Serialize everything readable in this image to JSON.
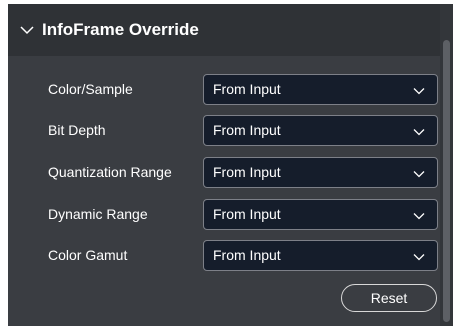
{
  "panel": {
    "title": "InfoFrame Override",
    "rows": [
      {
        "label": "Color/Sample",
        "value": "From Input"
      },
      {
        "label": "Bit Depth",
        "value": "From Input"
      },
      {
        "label": "Quantization Range",
        "value": "From Input"
      },
      {
        "label": "Dynamic Range",
        "value": "From Input"
      },
      {
        "label": "Color Gamut",
        "value": "From Input"
      }
    ],
    "reset_label": "Reset"
  },
  "colors": {
    "panel_background": "#3a3d42",
    "header_background": "#2f3236",
    "select_background": "#151d2b",
    "select_border": "#7d8088",
    "text": "#ffffff"
  },
  "icons": {
    "header_toggle": "chevron-down-icon",
    "select_toggle": "chevron-down-icon"
  }
}
